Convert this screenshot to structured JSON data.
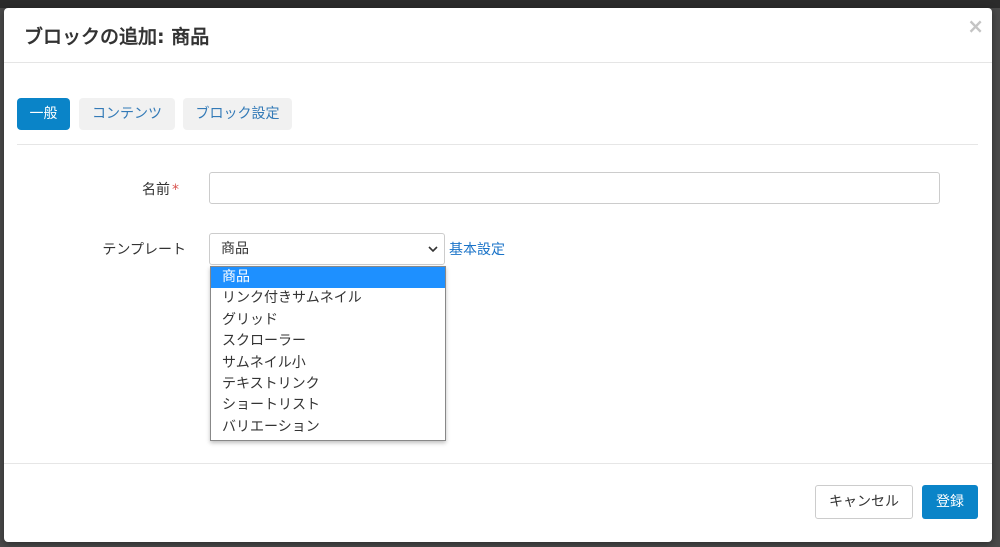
{
  "modal": {
    "title": "ブロックの追加: 商品",
    "close_label": "×"
  },
  "tabs": [
    {
      "label": "一般",
      "active": true
    },
    {
      "label": "コンテンツ",
      "active": false
    },
    {
      "label": "ブロック設定",
      "active": false
    }
  ],
  "form": {
    "name_label": "名前",
    "required_mark": "*",
    "name_value": "",
    "template_label": "テンプレート",
    "template_selected": "商品",
    "basic_settings_link": "基本設定"
  },
  "template_options": [
    "商品",
    "リンク付きサムネイル",
    "グリッド",
    "スクローラー",
    "サムネイル小",
    "テキストリンク",
    "ショートリスト",
    "バリエーション"
  ],
  "footer": {
    "cancel_label": "キャンセル",
    "submit_label": "登録"
  },
  "colors": {
    "primary": "#0a84c8",
    "link": "#1a73c8",
    "option_highlight": "#1e90ff",
    "required": "#d9534f"
  }
}
